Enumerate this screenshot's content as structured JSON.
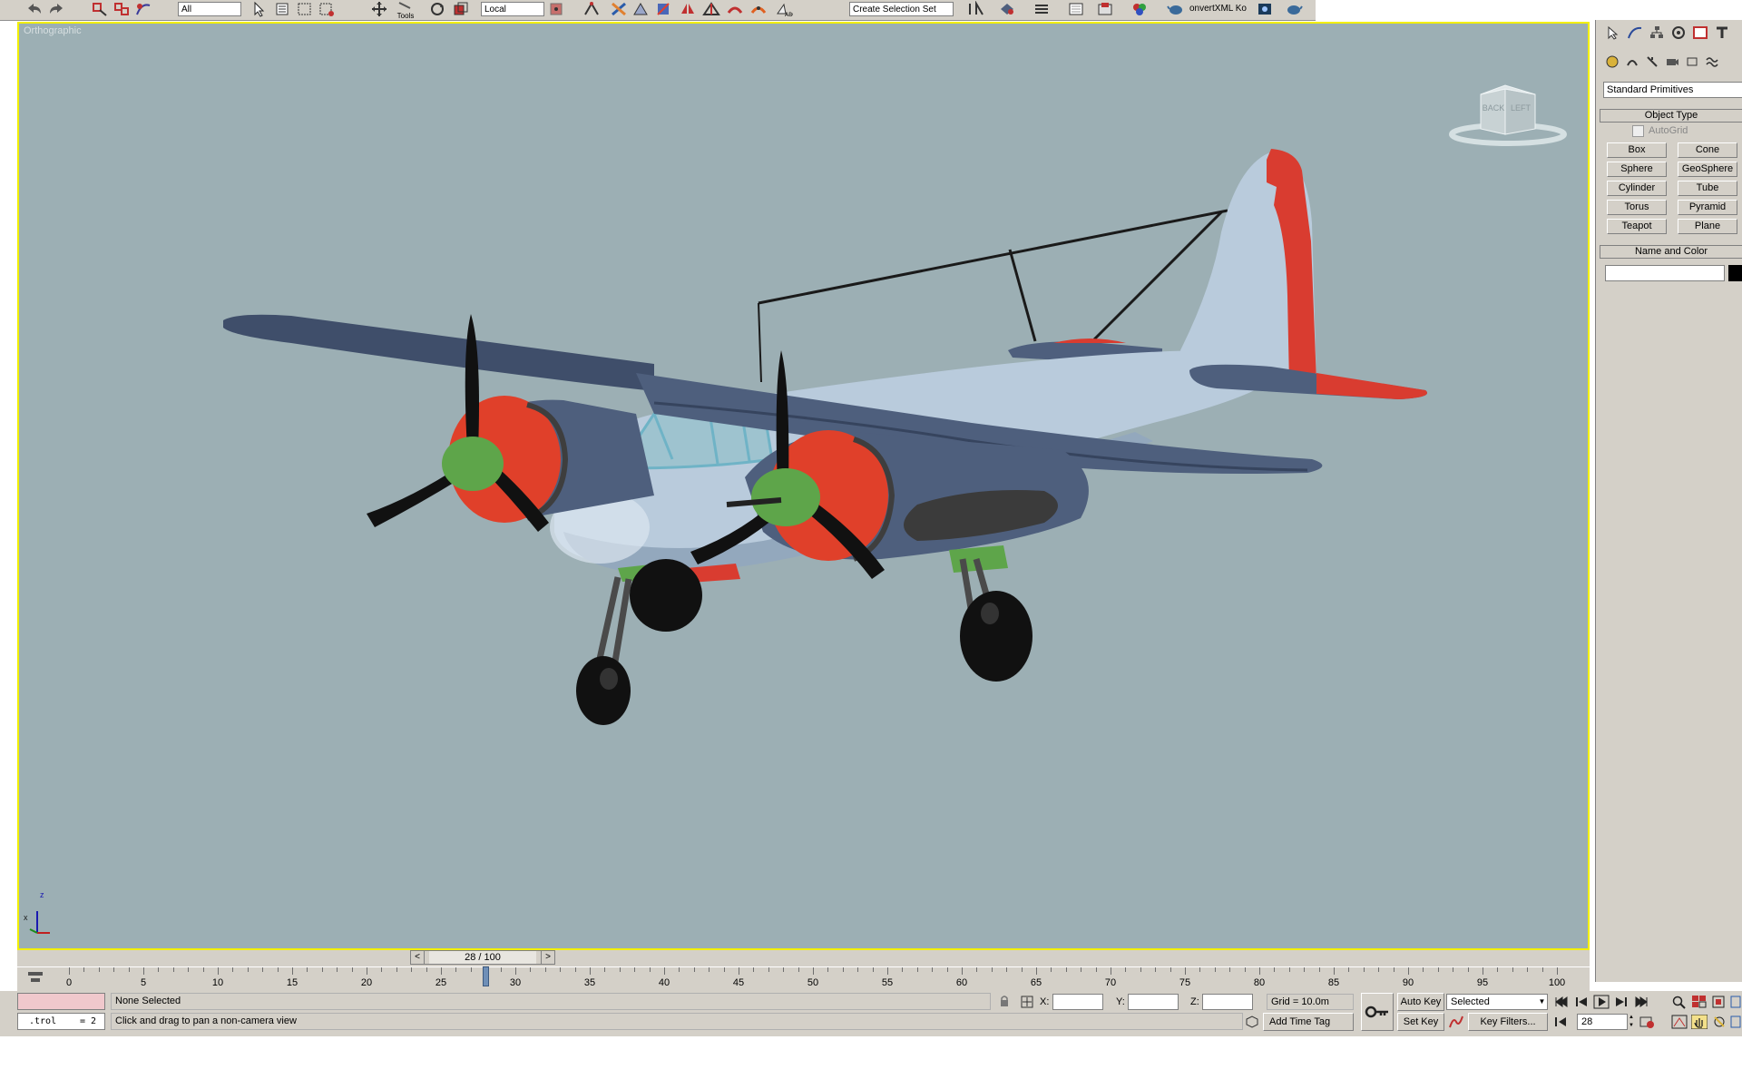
{
  "toolbar": {
    "selection_filter": "All",
    "ref_coord": "Local",
    "named_selection": "Create Selection Set",
    "plugin_label": "onvertXML Ko",
    "tools_label": "Tools"
  },
  "viewport": {
    "label": "Orthographic",
    "viewcube_back": "BACK",
    "viewcube_left": "LEFT",
    "axis_z": "z",
    "axis_x": "x"
  },
  "command_panel": {
    "category_dropdown": "Standard Primitives",
    "object_type_title": "Object Type",
    "autogrid_label": "AutoGrid",
    "buttons": [
      "Box",
      "Cone",
      "Sphere",
      "GeoSphere",
      "Cylinder",
      "Tube",
      "Torus",
      "Pyramid",
      "Teapot",
      "Plane"
    ],
    "name_color_title": "Name and Color",
    "name_value": ""
  },
  "timeline": {
    "frame_display": "28 / 100",
    "current_frame": 28,
    "total_frames": 100,
    "tick_labels": [
      "0",
      "5",
      "10",
      "15",
      "20",
      "25",
      "30",
      "35",
      "40",
      "45",
      "50",
      "55",
      "60",
      "65",
      "70",
      "75",
      "80",
      "85",
      "90",
      "95",
      "100"
    ]
  },
  "status": {
    "maxscript_text": ".trol",
    "maxscript_value": "= 2",
    "selection_status": "None Selected",
    "prompt": "Click and drag to pan a non-camera view",
    "x_label": "X:",
    "y_label": "Y:",
    "z_label": "Z:",
    "x_value": "",
    "y_value": "",
    "z_value": "",
    "grid": "Grid = 10.0m",
    "add_time_tag": "Add Time Tag",
    "auto_key": "Auto Key",
    "set_key": "Set Key",
    "selected_dropdown": "Selected",
    "key_filters": "Key Filters...",
    "frame_field": "28"
  },
  "colors": {
    "viewport_bg": "#9cafb4",
    "viewport_border": "#f3f000",
    "ui_gray": "#d4d0c8",
    "plane_body": "#b9cbdc",
    "plane_blue": "#4e5f7d",
    "nacelle_red": "#e0402a",
    "spinner_green": "#5ea54a",
    "time_slider": "#6f8fb7"
  }
}
